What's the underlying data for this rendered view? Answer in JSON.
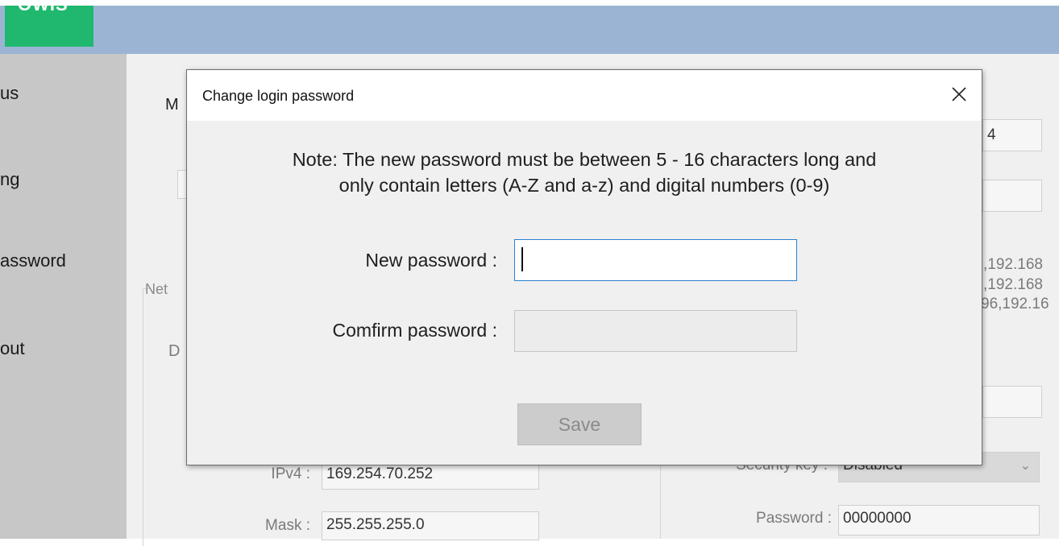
{
  "logo": {
    "text": "OWIS"
  },
  "sidebar": {
    "items": [
      {
        "label": "us"
      },
      {
        "label": "ng"
      },
      {
        "label": "assword"
      },
      {
        "label": "out"
      }
    ]
  },
  "background": {
    "main_label_fragment": "M",
    "group_label_fragment": "Net",
    "row_label_fragment": "D",
    "top_field_fragment": "4",
    "ip_fragments": [
      ",192.168",
      ",192.168",
      "96,192.16"
    ],
    "ipv4_label": "IPv4 :",
    "ipv4_value": "169.254.70.252",
    "mask_label": "Mask :",
    "mask_value": "255.255.255.0",
    "security_label": "Security key :",
    "security_value": "Disabled",
    "password_label": "Password :",
    "password_value": "00000000"
  },
  "dialog": {
    "title": "Change login password",
    "close_icon": "close-icon",
    "note_line1": "Note: The new password must be between 5 - 16 characters long and",
    "note_line2": "only contain letters (A-Z and a-z) and digital numbers (0-9)",
    "new_password_label": "New password :",
    "new_password_value": "",
    "confirm_password_label": "Comfirm password :",
    "confirm_password_value": "",
    "save_label": "Save"
  },
  "colors": {
    "header": "#9cb4d4",
    "logo": "#1fb86e",
    "sidebar": "#c7c7c7",
    "input_focus_border": "#2d7fd1"
  }
}
